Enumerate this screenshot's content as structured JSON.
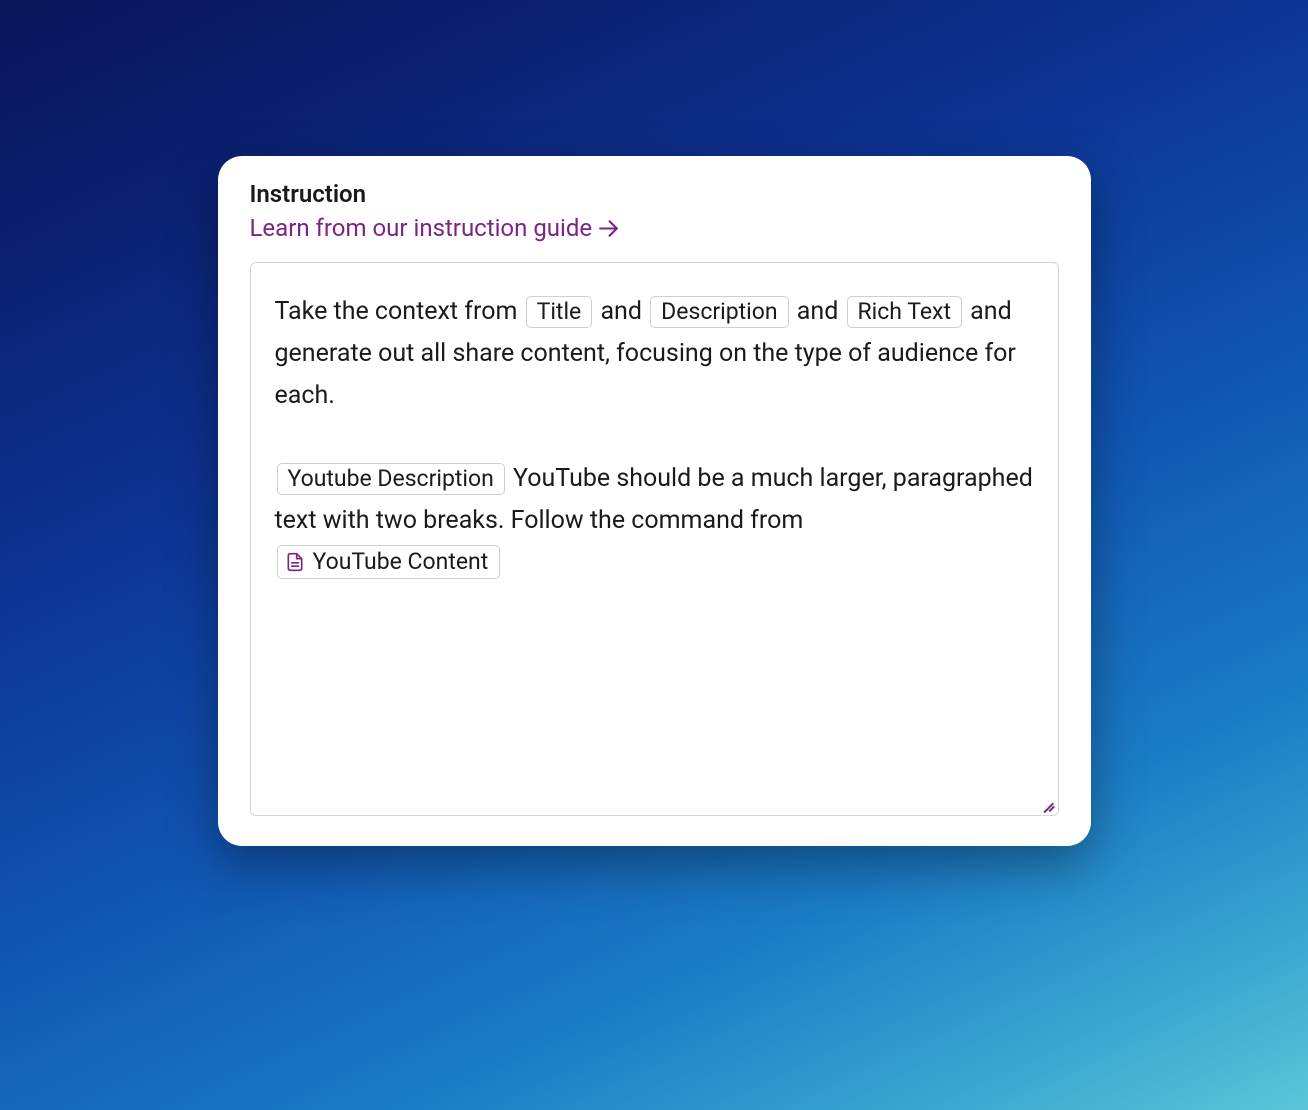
{
  "header": {
    "title": "Instruction",
    "guide_link_text": "Learn from our instruction guide"
  },
  "editor": {
    "paragraphs": [
      {
        "parts": [
          {
            "type": "text",
            "value": "Take the context from "
          },
          {
            "type": "chip",
            "value": "Title"
          },
          {
            "type": "text",
            "value": " and "
          },
          {
            "type": "chip",
            "value": "Description"
          },
          {
            "type": "text",
            "value": " and "
          },
          {
            "type": "chip",
            "value": "Rich Text"
          },
          {
            "type": "text",
            "value": " and generate out all share content, focusing on the type of audience for each."
          }
        ]
      },
      {
        "parts": [
          {
            "type": "chip",
            "value": "Youtube Description"
          },
          {
            "type": "text",
            "value": " YouTube should be a much larger, paragraphed text with two breaks. Follow the command from "
          },
          {
            "type": "icon-chip",
            "icon": "document-icon",
            "value": "YouTube Content"
          }
        ]
      }
    ]
  }
}
